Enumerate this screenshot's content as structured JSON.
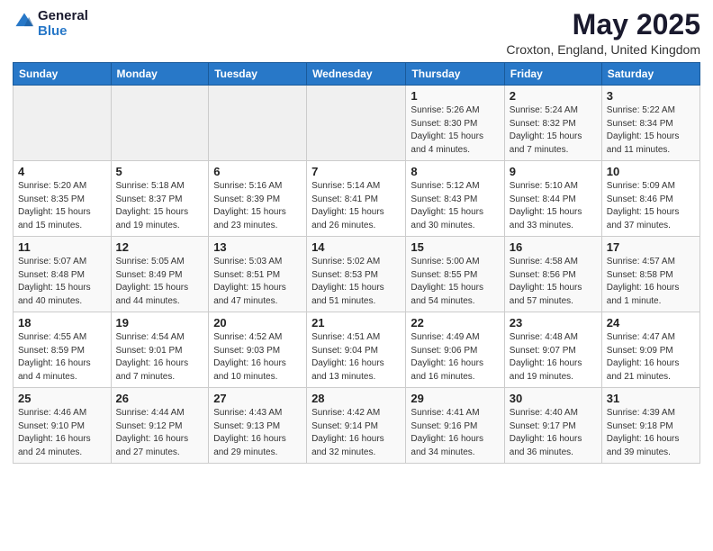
{
  "header": {
    "logo_general": "General",
    "logo_blue": "Blue",
    "title": "May 2025",
    "subtitle": "Croxton, England, United Kingdom"
  },
  "weekdays": [
    "Sunday",
    "Monday",
    "Tuesday",
    "Wednesday",
    "Thursday",
    "Friday",
    "Saturday"
  ],
  "weeks": [
    [
      {
        "day": "",
        "info": ""
      },
      {
        "day": "",
        "info": ""
      },
      {
        "day": "",
        "info": ""
      },
      {
        "day": "",
        "info": ""
      },
      {
        "day": "1",
        "info": "Sunrise: 5:26 AM\nSunset: 8:30 PM\nDaylight: 15 hours\nand 4 minutes."
      },
      {
        "day": "2",
        "info": "Sunrise: 5:24 AM\nSunset: 8:32 PM\nDaylight: 15 hours\nand 7 minutes."
      },
      {
        "day": "3",
        "info": "Sunrise: 5:22 AM\nSunset: 8:34 PM\nDaylight: 15 hours\nand 11 minutes."
      }
    ],
    [
      {
        "day": "4",
        "info": "Sunrise: 5:20 AM\nSunset: 8:35 PM\nDaylight: 15 hours\nand 15 minutes."
      },
      {
        "day": "5",
        "info": "Sunrise: 5:18 AM\nSunset: 8:37 PM\nDaylight: 15 hours\nand 19 minutes."
      },
      {
        "day": "6",
        "info": "Sunrise: 5:16 AM\nSunset: 8:39 PM\nDaylight: 15 hours\nand 23 minutes."
      },
      {
        "day": "7",
        "info": "Sunrise: 5:14 AM\nSunset: 8:41 PM\nDaylight: 15 hours\nand 26 minutes."
      },
      {
        "day": "8",
        "info": "Sunrise: 5:12 AM\nSunset: 8:43 PM\nDaylight: 15 hours\nand 30 minutes."
      },
      {
        "day": "9",
        "info": "Sunrise: 5:10 AM\nSunset: 8:44 PM\nDaylight: 15 hours\nand 33 minutes."
      },
      {
        "day": "10",
        "info": "Sunrise: 5:09 AM\nSunset: 8:46 PM\nDaylight: 15 hours\nand 37 minutes."
      }
    ],
    [
      {
        "day": "11",
        "info": "Sunrise: 5:07 AM\nSunset: 8:48 PM\nDaylight: 15 hours\nand 40 minutes."
      },
      {
        "day": "12",
        "info": "Sunrise: 5:05 AM\nSunset: 8:49 PM\nDaylight: 15 hours\nand 44 minutes."
      },
      {
        "day": "13",
        "info": "Sunrise: 5:03 AM\nSunset: 8:51 PM\nDaylight: 15 hours\nand 47 minutes."
      },
      {
        "day": "14",
        "info": "Sunrise: 5:02 AM\nSunset: 8:53 PM\nDaylight: 15 hours\nand 51 minutes."
      },
      {
        "day": "15",
        "info": "Sunrise: 5:00 AM\nSunset: 8:55 PM\nDaylight: 15 hours\nand 54 minutes."
      },
      {
        "day": "16",
        "info": "Sunrise: 4:58 AM\nSunset: 8:56 PM\nDaylight: 15 hours\nand 57 minutes."
      },
      {
        "day": "17",
        "info": "Sunrise: 4:57 AM\nSunset: 8:58 PM\nDaylight: 16 hours\nand 1 minute."
      }
    ],
    [
      {
        "day": "18",
        "info": "Sunrise: 4:55 AM\nSunset: 8:59 PM\nDaylight: 16 hours\nand 4 minutes."
      },
      {
        "day": "19",
        "info": "Sunrise: 4:54 AM\nSunset: 9:01 PM\nDaylight: 16 hours\nand 7 minutes."
      },
      {
        "day": "20",
        "info": "Sunrise: 4:52 AM\nSunset: 9:03 PM\nDaylight: 16 hours\nand 10 minutes."
      },
      {
        "day": "21",
        "info": "Sunrise: 4:51 AM\nSunset: 9:04 PM\nDaylight: 16 hours\nand 13 minutes."
      },
      {
        "day": "22",
        "info": "Sunrise: 4:49 AM\nSunset: 9:06 PM\nDaylight: 16 hours\nand 16 minutes."
      },
      {
        "day": "23",
        "info": "Sunrise: 4:48 AM\nSunset: 9:07 PM\nDaylight: 16 hours\nand 19 minutes."
      },
      {
        "day": "24",
        "info": "Sunrise: 4:47 AM\nSunset: 9:09 PM\nDaylight: 16 hours\nand 21 minutes."
      }
    ],
    [
      {
        "day": "25",
        "info": "Sunrise: 4:46 AM\nSunset: 9:10 PM\nDaylight: 16 hours\nand 24 minutes."
      },
      {
        "day": "26",
        "info": "Sunrise: 4:44 AM\nSunset: 9:12 PM\nDaylight: 16 hours\nand 27 minutes."
      },
      {
        "day": "27",
        "info": "Sunrise: 4:43 AM\nSunset: 9:13 PM\nDaylight: 16 hours\nand 29 minutes."
      },
      {
        "day": "28",
        "info": "Sunrise: 4:42 AM\nSunset: 9:14 PM\nDaylight: 16 hours\nand 32 minutes."
      },
      {
        "day": "29",
        "info": "Sunrise: 4:41 AM\nSunset: 9:16 PM\nDaylight: 16 hours\nand 34 minutes."
      },
      {
        "day": "30",
        "info": "Sunrise: 4:40 AM\nSunset: 9:17 PM\nDaylight: 16 hours\nand 36 minutes."
      },
      {
        "day": "31",
        "info": "Sunrise: 4:39 AM\nSunset: 9:18 PM\nDaylight: 16 hours\nand 39 minutes."
      }
    ]
  ]
}
